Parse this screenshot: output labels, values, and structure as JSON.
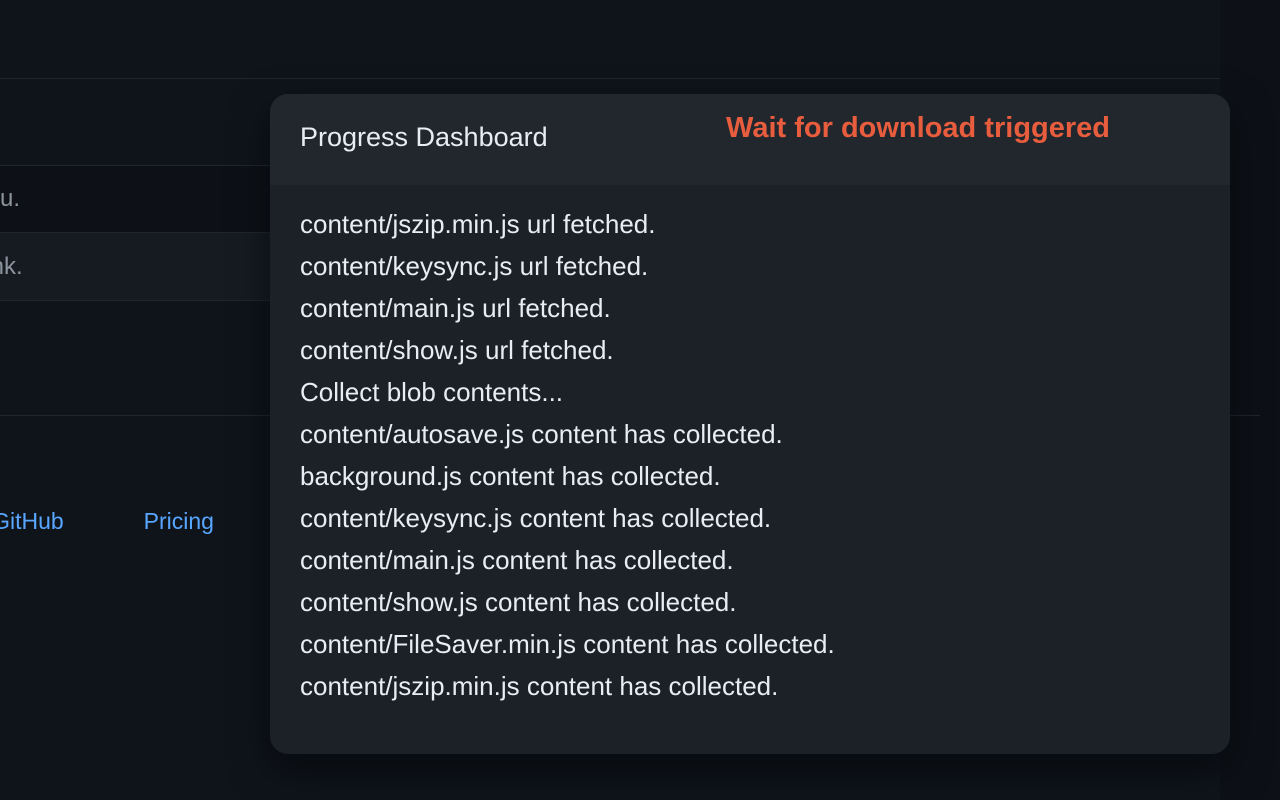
{
  "background": {
    "row1_text": "nenu.",
    "row2_text": "n link.",
    "link1": "act GitHub",
    "link2": "Pricing"
  },
  "modal": {
    "title": "Progress Dashboard",
    "status": "Wait for download triggered",
    "log": [
      "content/jszip.min.js url fetched.",
      "content/keysync.js url fetched.",
      "content/main.js url fetched.",
      "content/show.js url fetched.",
      "Collect blob contents...",
      "content/autosave.js content has collected.",
      "background.js content has collected.",
      "content/keysync.js content has collected.",
      "content/main.js content has collected.",
      "content/show.js content has collected.",
      "content/FileSaver.min.js content has collected.",
      "content/jszip.min.js content has collected."
    ]
  }
}
